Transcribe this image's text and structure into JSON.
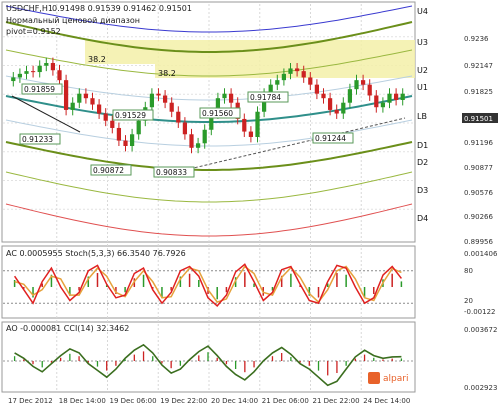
{
  "header": {
    "symbol": "USDCHF,H1",
    "ohlc": "0.91498 0.91539 0.91462 0.91501",
    "note_line1": "Нормальный ценовой диапазон",
    "note_line2": "pivot=0.9152"
  },
  "chart_data": [
    {
      "type": "line",
      "title": "USDCHF,H1",
      "x_tick_labels": [
        "17 Dec 2012",
        "18 Dec 14:00",
        "19 Dec 06:00",
        "19 Dec 22:00",
        "20 Dec 14:00",
        "21 Dec 06:00",
        "21 Dec 22:00",
        "24 Dec 14:00"
      ],
      "price_axis_labels": [
        "0.9236",
        "0.92147",
        "0.91825",
        "0.91501",
        "0.91196",
        "0.90877",
        "0.90576",
        "0.90266",
        "0.89956"
      ],
      "current_price": "0.91501",
      "band_labels": [
        "U4",
        "U3",
        "U2",
        "U1",
        "LB",
        "D1",
        "D2",
        "D3",
        "D4"
      ],
      "fib_labels": [
        "38.2",
        "38.2"
      ],
      "price_annotations": [
        "0.91859",
        "0.91529",
        "0.91560",
        "0.91784",
        "0.91233",
        "0.90872",
        "0.90833",
        "0.91244"
      ],
      "closes": [
        0.9168,
        0.9172,
        0.9175,
        0.9174,
        0.9181,
        0.9184,
        0.9176,
        0.9165,
        0.9132,
        0.914,
        0.915,
        0.9145,
        0.9138,
        0.9128,
        0.912,
        0.9112,
        0.9098,
        0.9092,
        0.9105,
        0.912,
        0.9135,
        0.915,
        0.9148,
        0.914,
        0.913,
        0.9118,
        0.9105,
        0.909,
        0.9095,
        0.911,
        0.9128,
        0.9145,
        0.915,
        0.914,
        0.9122,
        0.9108,
        0.9102,
        0.913,
        0.915,
        0.916,
        0.9165,
        0.9172,
        0.9178,
        0.9175,
        0.9168,
        0.916,
        0.915,
        0.9145,
        0.9132,
        0.9128,
        0.914,
        0.9155,
        0.9165,
        0.916,
        0.9148,
        0.9135,
        0.914,
        0.915,
        0.9143,
        0.915
      ]
    },
    {
      "type": "line",
      "title": "AC 0.0005955 Stoch(5,3,3) 66.3540 76.7926",
      "price_axis_labels": [
        "0.001406",
        "80",
        "20",
        "-0.00122"
      ],
      "stoch_main": [
        70,
        45,
        20,
        60,
        85,
        50,
        25,
        40,
        80,
        90,
        55,
        30,
        35,
        75,
        85,
        45,
        20,
        40,
        80,
        88,
        70,
        30,
        15,
        35,
        78,
        92,
        60,
        25,
        40,
        82,
        88,
        55,
        25,
        20,
        60,
        90,
        85,
        50,
        20,
        30,
        72,
        88,
        66
      ],
      "stoch_signal": [
        60,
        55,
        35,
        45,
        70,
        65,
        35,
        35,
        65,
        85,
        70,
        40,
        32,
        60,
        80,
        60,
        30,
        32,
        65,
        85,
        80,
        45,
        22,
        28,
        62,
        88,
        75,
        40,
        35,
        68,
        86,
        68,
        38,
        22,
        45,
        80,
        88,
        65,
        30,
        25,
        58,
        84,
        77
      ]
    },
    {
      "type": "line",
      "title": "AO -0.000081 CCI(14) 32.3462",
      "price_axis_labels": [
        "0.003672",
        "0.002923"
      ],
      "cci": [
        60,
        20,
        -40,
        -80,
        -20,
        40,
        90,
        60,
        -20,
        -70,
        -120,
        -60,
        20,
        80,
        120,
        60,
        -30,
        -90,
        -60,
        10,
        70,
        110,
        40,
        -40,
        -100,
        -140,
        -80,
        0,
        60,
        100,
        50,
        -20,
        -60,
        -120,
        -180,
        -150,
        -60,
        30,
        80,
        40,
        20,
        30,
        32
      ]
    }
  ],
  "footer": {
    "logo_text": "alpari"
  }
}
